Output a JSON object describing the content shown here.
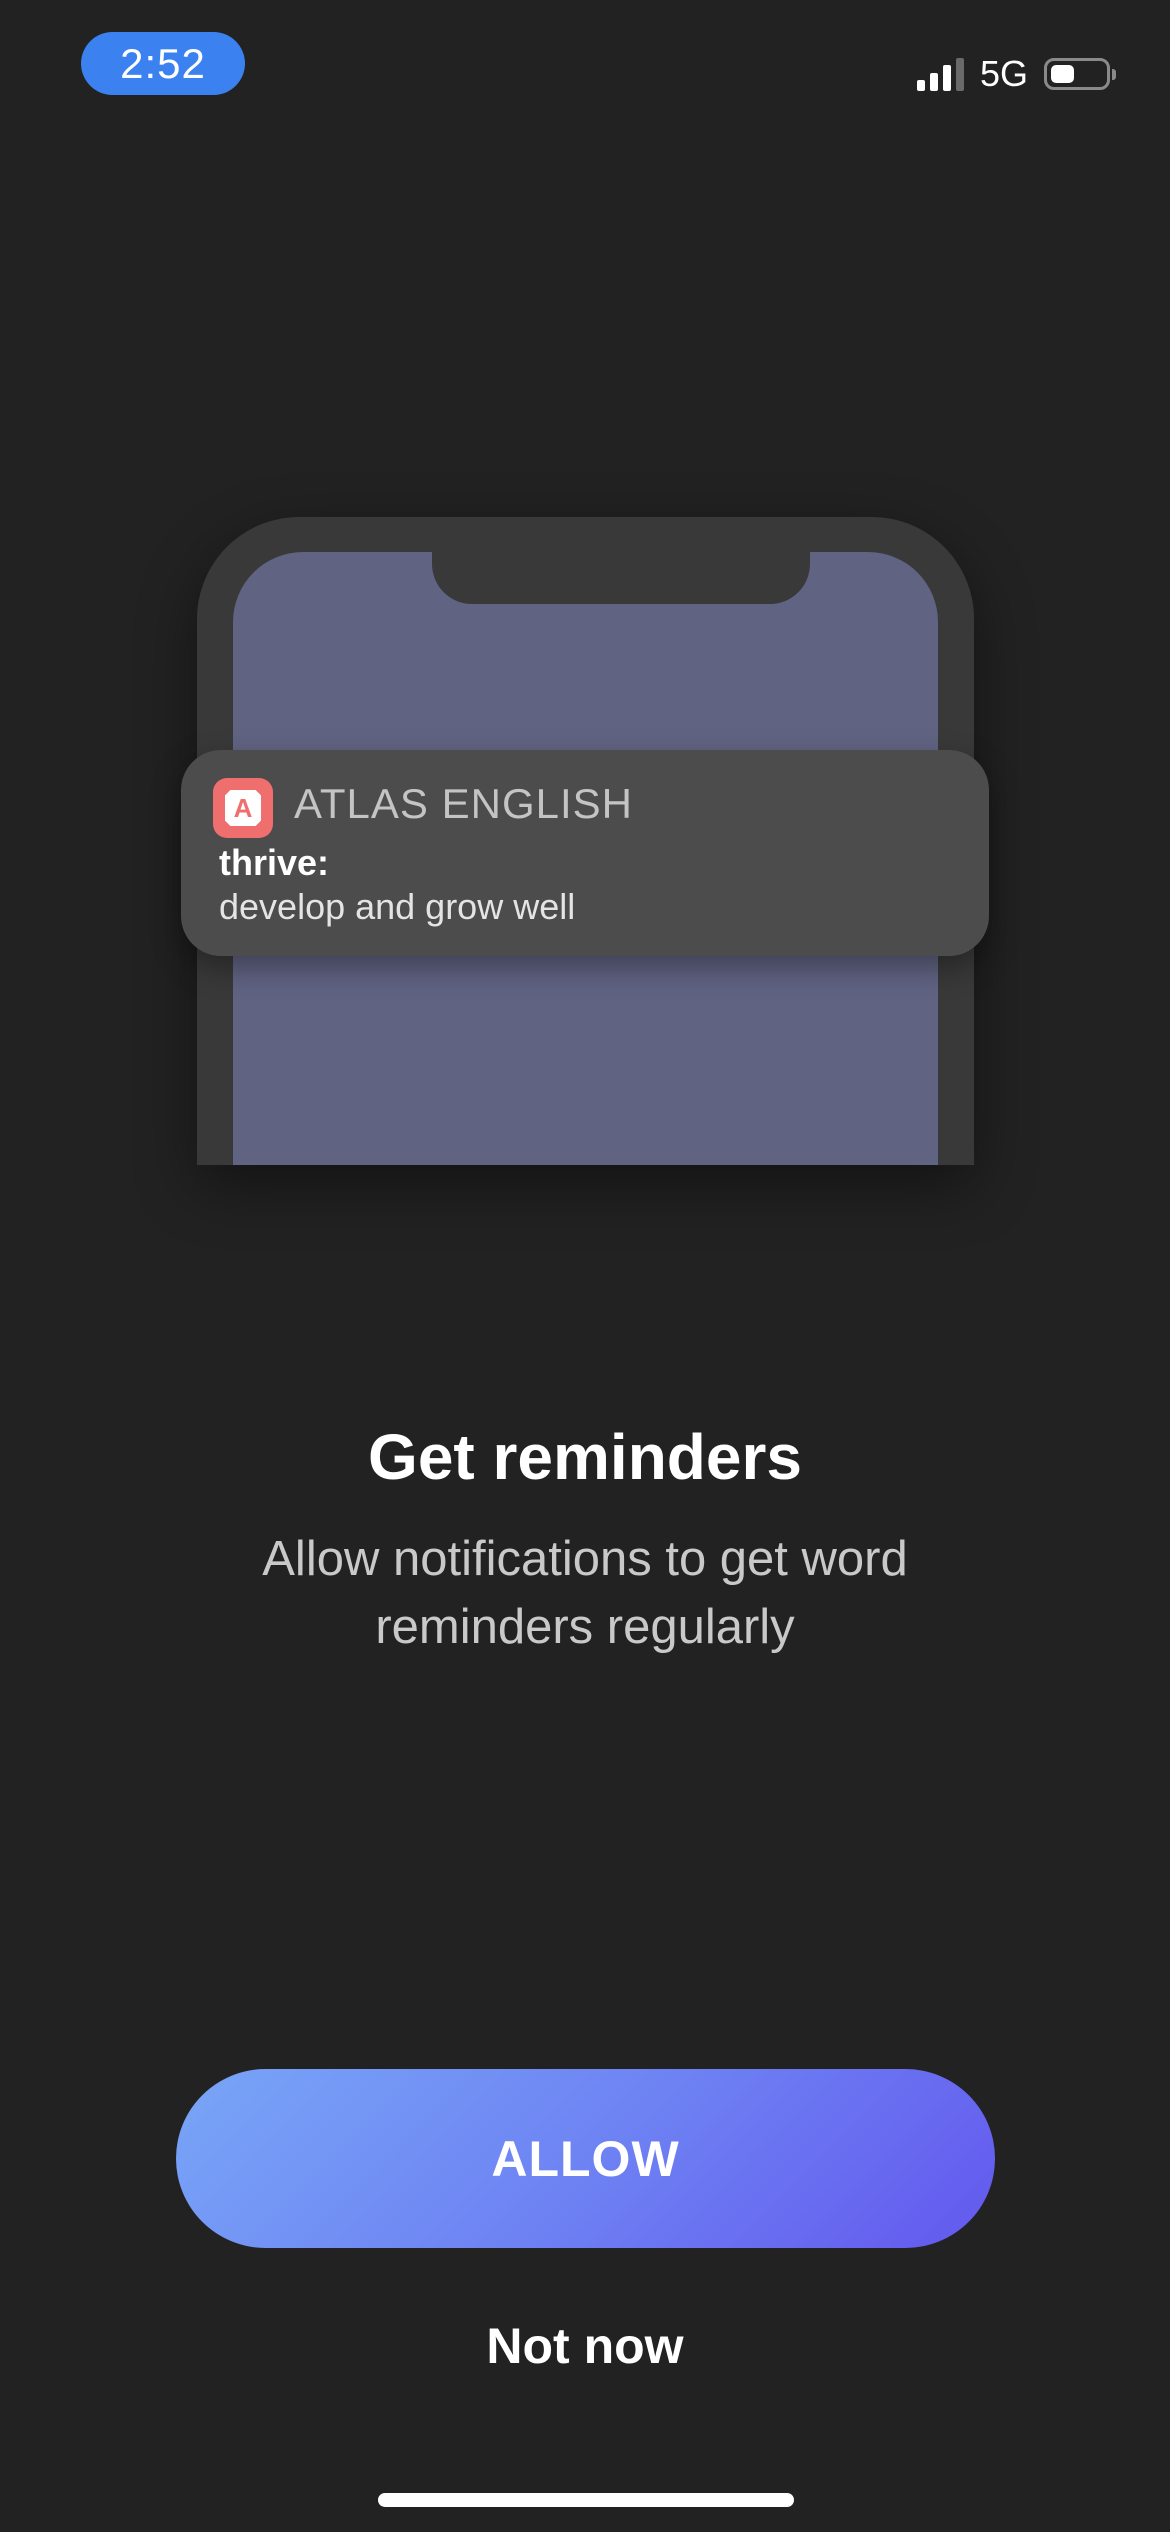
{
  "status_bar": {
    "time": "2:52",
    "network": "5G",
    "battery_level": 0.45,
    "signal_bars": 3,
    "icons": [
      "signal-icon",
      "battery-icon"
    ]
  },
  "notification": {
    "app_name": "ATLAS ENGLISH",
    "app_icon_letter": "A",
    "title": "thrive:",
    "body": "develop and grow well",
    "icon": "app-icon"
  },
  "main": {
    "heading": "Get reminders",
    "subheading": "Allow notifications to get word reminders regularly"
  },
  "actions": {
    "allow_label": "ALLOW",
    "not_now_label": "Not now"
  },
  "colors": {
    "background": "#222222",
    "time_pill": "#3b82f0",
    "phone_screen": "#616383",
    "app_icon": "#ef6e6e",
    "button_gradient_start": "#78a6f7",
    "button_gradient_end": "#6358ee"
  }
}
